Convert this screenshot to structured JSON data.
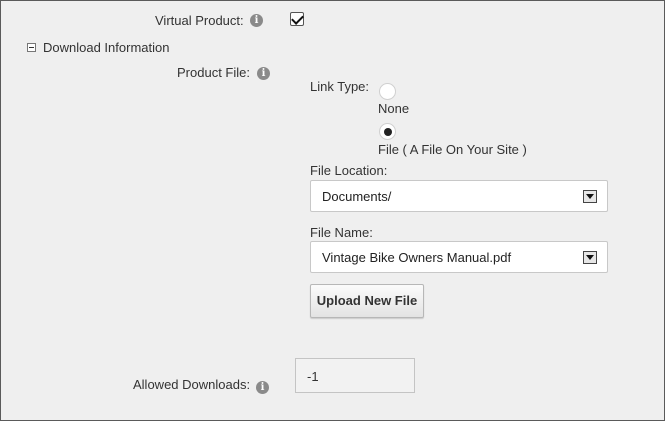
{
  "virtual_product": {
    "label": "Virtual Product:",
    "checked": true
  },
  "download_section": {
    "title": "Download Information"
  },
  "product_file": {
    "label": "Product File:",
    "link_type_label": "Link Type:",
    "options": [
      {
        "label": "None",
        "selected": false
      },
      {
        "label": "File ( A File On Your Site )",
        "selected": true
      }
    ],
    "file_location_label": "File Location:",
    "file_location_value": "Documents/",
    "file_name_label": "File Name:",
    "file_name_value": "Vintage Bike Owners Manual.pdf",
    "upload_button": "Upload New File"
  },
  "allowed_downloads": {
    "label": "Allowed Downloads:",
    "value": "-1"
  },
  "icons": {
    "info": "i"
  }
}
